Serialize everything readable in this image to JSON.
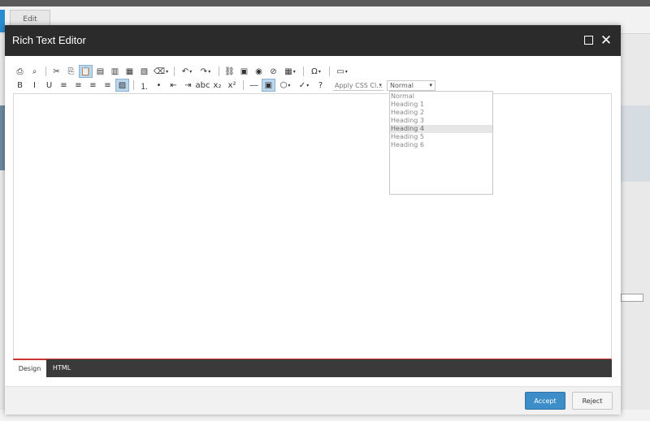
{
  "background": {
    "tab_label": "Edit"
  },
  "modal": {
    "title": "Rich Text Editor",
    "maximize_icon": "maximize-icon",
    "close_icon": "close-icon",
    "close_glyph": "✕"
  },
  "toolbar": {
    "css_class_placeholder": "Apply CSS Cl...",
    "paragraph_value": "Normal",
    "row1": [
      {
        "name": "print-icon",
        "glyph": "⎙"
      },
      {
        "name": "find-icon",
        "glyph": "⌕"
      },
      {
        "name": "cut-icon",
        "glyph": "✂"
      },
      {
        "name": "copy-icon",
        "glyph": "⎘"
      },
      {
        "name": "paste-icon",
        "glyph": "📋"
      },
      {
        "name": "paste-word-icon",
        "glyph": "▤"
      },
      {
        "name": "paste-text-icon",
        "glyph": "▥"
      },
      {
        "name": "paste-html-icon",
        "glyph": "▦"
      },
      {
        "name": "paste-plain-icon",
        "glyph": "▧"
      },
      {
        "name": "format-stripper-icon",
        "glyph": "⌫"
      },
      {
        "name": "undo-icon",
        "glyph": "↶"
      },
      {
        "name": "redo-icon",
        "glyph": "↷"
      },
      {
        "name": "insert-link-icon",
        "glyph": "⛓"
      },
      {
        "name": "insert-image-icon",
        "glyph": "▣"
      },
      {
        "name": "insert-media-icon",
        "glyph": "◉"
      },
      {
        "name": "remove-link-icon",
        "glyph": "⊘"
      },
      {
        "name": "insert-table-icon",
        "glyph": "▦"
      },
      {
        "name": "insert-symbol-icon",
        "glyph": "Ω"
      },
      {
        "name": "insert-snippet-icon",
        "glyph": "▭"
      }
    ],
    "row2": [
      {
        "name": "bold-icon",
        "glyph": "B"
      },
      {
        "name": "italic-icon",
        "glyph": "I"
      },
      {
        "name": "underline-icon",
        "glyph": "U"
      },
      {
        "name": "align-left-icon",
        "glyph": "≡"
      },
      {
        "name": "align-center-icon",
        "glyph": "≡"
      },
      {
        "name": "align-right-icon",
        "glyph": "≡"
      },
      {
        "name": "justify-icon",
        "glyph": "≡"
      },
      {
        "name": "no-align-icon",
        "glyph": "▨"
      },
      {
        "name": "numbered-list-icon",
        "glyph": "⒈"
      },
      {
        "name": "bullet-list-icon",
        "glyph": "•"
      },
      {
        "name": "outdent-icon",
        "glyph": "⇤"
      },
      {
        "name": "indent-icon",
        "glyph": "⇥"
      },
      {
        "name": "spell-check-icon",
        "glyph": "abc"
      },
      {
        "name": "subscript-icon",
        "glyph": "x₂"
      },
      {
        "name": "superscript-icon",
        "glyph": "x²"
      },
      {
        "name": "horizontal-rule-icon",
        "glyph": "―"
      },
      {
        "name": "image-map-icon",
        "glyph": "▣"
      },
      {
        "name": "insert-shape-icon",
        "glyph": "⬡"
      },
      {
        "name": "ajax-spellcheck-icon",
        "glyph": "✓"
      },
      {
        "name": "help-icon",
        "glyph": "?"
      }
    ]
  },
  "dropdown": {
    "items": [
      "Normal",
      "Heading 1",
      "Heading 2",
      "Heading 3",
      "Heading 4",
      "Heading 5",
      "Heading 6"
    ],
    "highlighted": "Heading 4"
  },
  "mode_tabs": {
    "design": "Design",
    "html": "HTML"
  },
  "footer": {
    "accept": "Accept",
    "reject": "Reject"
  },
  "colors": {
    "header_bg": "#2b2b2b",
    "accept_bg": "#3d8ec8",
    "accent_red": "#cc3333"
  }
}
